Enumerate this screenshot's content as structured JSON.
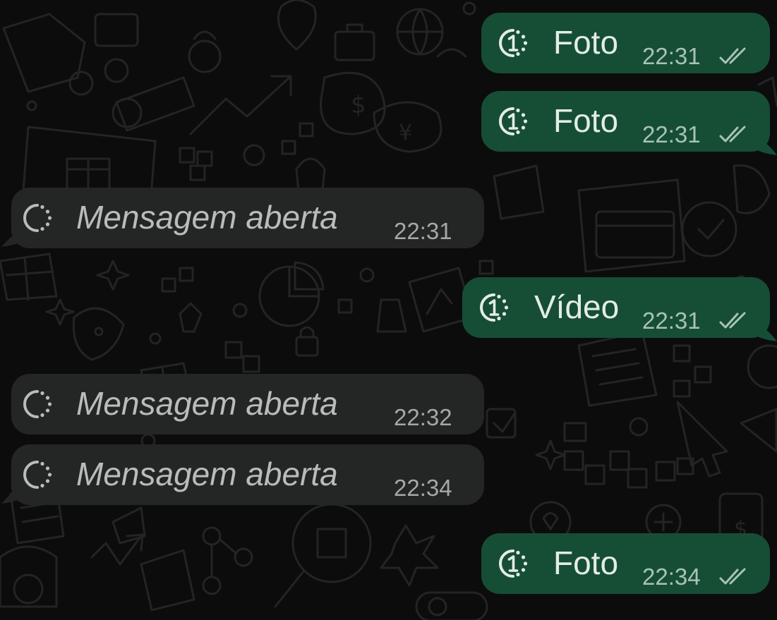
{
  "colors": {
    "background": "#0c0c0c",
    "outgoing_bubble": "#164e35",
    "incoming_bubble": "#242626",
    "outgoing_text": "#e3ece6",
    "incoming_text": "#b9bcbc",
    "doodle_lines": "#242424"
  },
  "messages": [
    {
      "direction": "outgoing",
      "icon": "view-once-icon",
      "label": "Foto",
      "time": "22:31",
      "status": "read-ticks-icon"
    },
    {
      "direction": "outgoing",
      "icon": "view-once-icon",
      "label": "Foto",
      "time": "22:31",
      "status": "read-ticks-icon"
    },
    {
      "direction": "incoming",
      "icon": "view-once-opened-icon",
      "label": "Mensagem aberta",
      "time": "22:31"
    },
    {
      "direction": "outgoing",
      "icon": "view-once-icon",
      "label": "Vídeo",
      "time": "22:31",
      "status": "read-ticks-icon"
    },
    {
      "direction": "incoming",
      "icon": "view-once-opened-icon",
      "label": "Mensagem aberta",
      "time": "22:32"
    },
    {
      "direction": "incoming",
      "icon": "view-once-opened-icon",
      "label": "Mensagem aberta",
      "time": "22:34"
    },
    {
      "direction": "outgoing",
      "icon": "view-once-icon",
      "label": "Foto",
      "time": "22:34",
      "status": "read-ticks-icon"
    }
  ]
}
